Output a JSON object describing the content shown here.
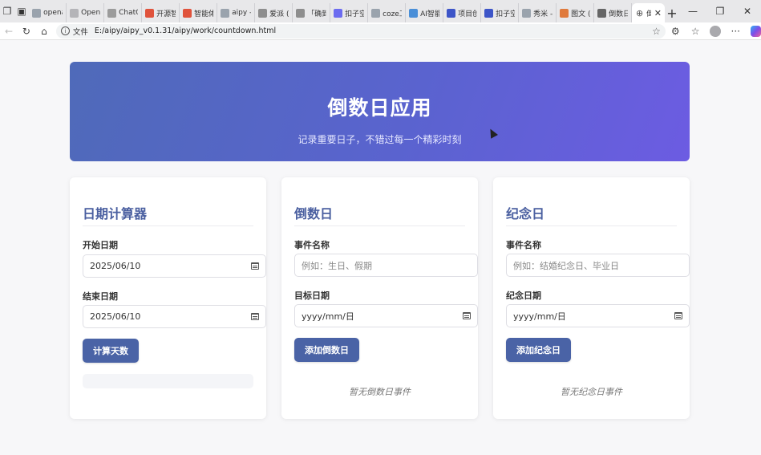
{
  "browser": {
    "tabs": [
      {
        "label": "opena",
        "color": "#9aa3ad"
      },
      {
        "label": "OpenA",
        "color": "#b4b4b8"
      },
      {
        "label": "ChatG",
        "color": "#9b9b9b"
      },
      {
        "label": "开源智",
        "color": "#e0533c"
      },
      {
        "label": "智能体",
        "color": "#e0533c"
      },
      {
        "label": "aipy -",
        "color": "#9aa3ad"
      },
      {
        "label": "爱派 (",
        "color": "#8e8e8e"
      },
      {
        "label": "「确到",
        "color": "#8e8e8e"
      },
      {
        "label": "扣子空",
        "color": "#6c6cf0"
      },
      {
        "label": "coze工",
        "color": "#9aa3ad"
      },
      {
        "label": "AI智能",
        "color": "#4a8fd8"
      },
      {
        "label": "项目创",
        "color": "#3d55c8"
      },
      {
        "label": "扣子空",
        "color": "#3d55c8"
      },
      {
        "label": "秀米 -",
        "color": "#9aa3ad"
      },
      {
        "label": "图文 (",
        "color": "#e07a3c"
      },
      {
        "label": "倒数日",
        "color": "#666666"
      }
    ],
    "active_tab": {
      "label": "倒"
    },
    "address": {
      "protocol": "文件",
      "url": "E:/aipy/aipy_v0.1.31/aipy/work/countdown.html"
    }
  },
  "hero": {
    "title": "倒数日应用",
    "subtitle": "记录重要日子，不错过每一个精彩时刻"
  },
  "calculator": {
    "title": "日期计算器",
    "start_label": "开始日期",
    "start_value": "2025/06/10",
    "end_label": "结束日期",
    "end_value": "2025/06/10",
    "button": "计算天数"
  },
  "countdown": {
    "title": "倒数日",
    "name_label": "事件名称",
    "name_placeholder": "例如：生日、假期",
    "date_label": "目标日期",
    "date_placeholder": "yyyy/mm/日",
    "button": "添加倒数日",
    "empty": "暂无倒数日事件"
  },
  "anniversary": {
    "title": "纪念日",
    "name_label": "事件名称",
    "name_placeholder": "例如：结婚纪念日、毕业日",
    "date_label": "纪念日期",
    "date_placeholder": "yyyy/mm/日",
    "button": "添加纪念日",
    "empty": "暂无纪念日事件"
  },
  "colors": {
    "accent": "#4a63a6",
    "heading": "#4a5fa0",
    "hero_start": "#4f6ab9",
    "hero_end": "#6c5ce2"
  }
}
